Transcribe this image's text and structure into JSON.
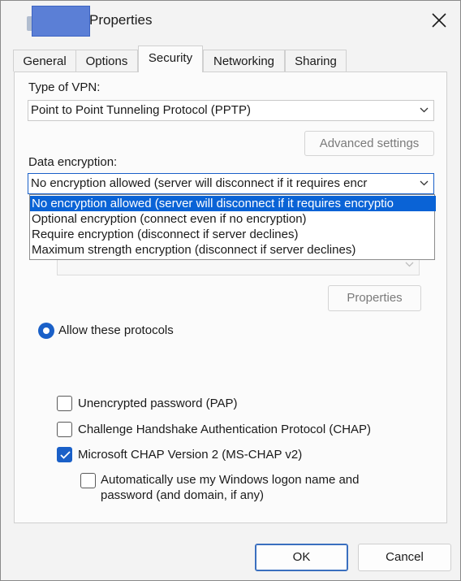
{
  "window": {
    "title": "Properties",
    "close_icon": "close-icon"
  },
  "tabs": [
    {
      "label": "General"
    },
    {
      "label": "Options"
    },
    {
      "label": "Security",
      "active": true
    },
    {
      "label": "Networking"
    },
    {
      "label": "Sharing"
    }
  ],
  "vpn": {
    "label": "Type of VPN:",
    "value": "Point to Point Tunneling Protocol (PPTP)"
  },
  "advanced_settings_label": "Advanced settings",
  "encryption": {
    "label": "Data encryption:",
    "value": "No encryption allowed (server will disconnect if it requires encr",
    "options": [
      "No encryption allowed (server will disconnect if it requires encryptio",
      "Optional encryption (connect even if no encryption)",
      "Require encryption (disconnect if server declines)",
      "Maximum strength encryption (disconnect if server declines)"
    ],
    "selected_index": 0
  },
  "properties_label": "Properties",
  "protocols_radio_label": "Allow these protocols",
  "checkboxes": [
    {
      "label": "Unencrypted password (PAP)",
      "checked": false
    },
    {
      "label": "Challenge Handshake Authentication Protocol (CHAP)",
      "checked": false
    },
    {
      "label": "Microsoft CHAP Version 2 (MS-CHAP v2)",
      "checked": true
    },
    {
      "label_line1": "Automatically use my Windows logon name and",
      "label_line2": "password (and domain, if any)",
      "checked": false
    }
  ],
  "footer": {
    "ok_label": "OK",
    "cancel_label": "Cancel"
  },
  "colors": {
    "accent": "#1a60c8",
    "selection": "#0a63d6"
  }
}
